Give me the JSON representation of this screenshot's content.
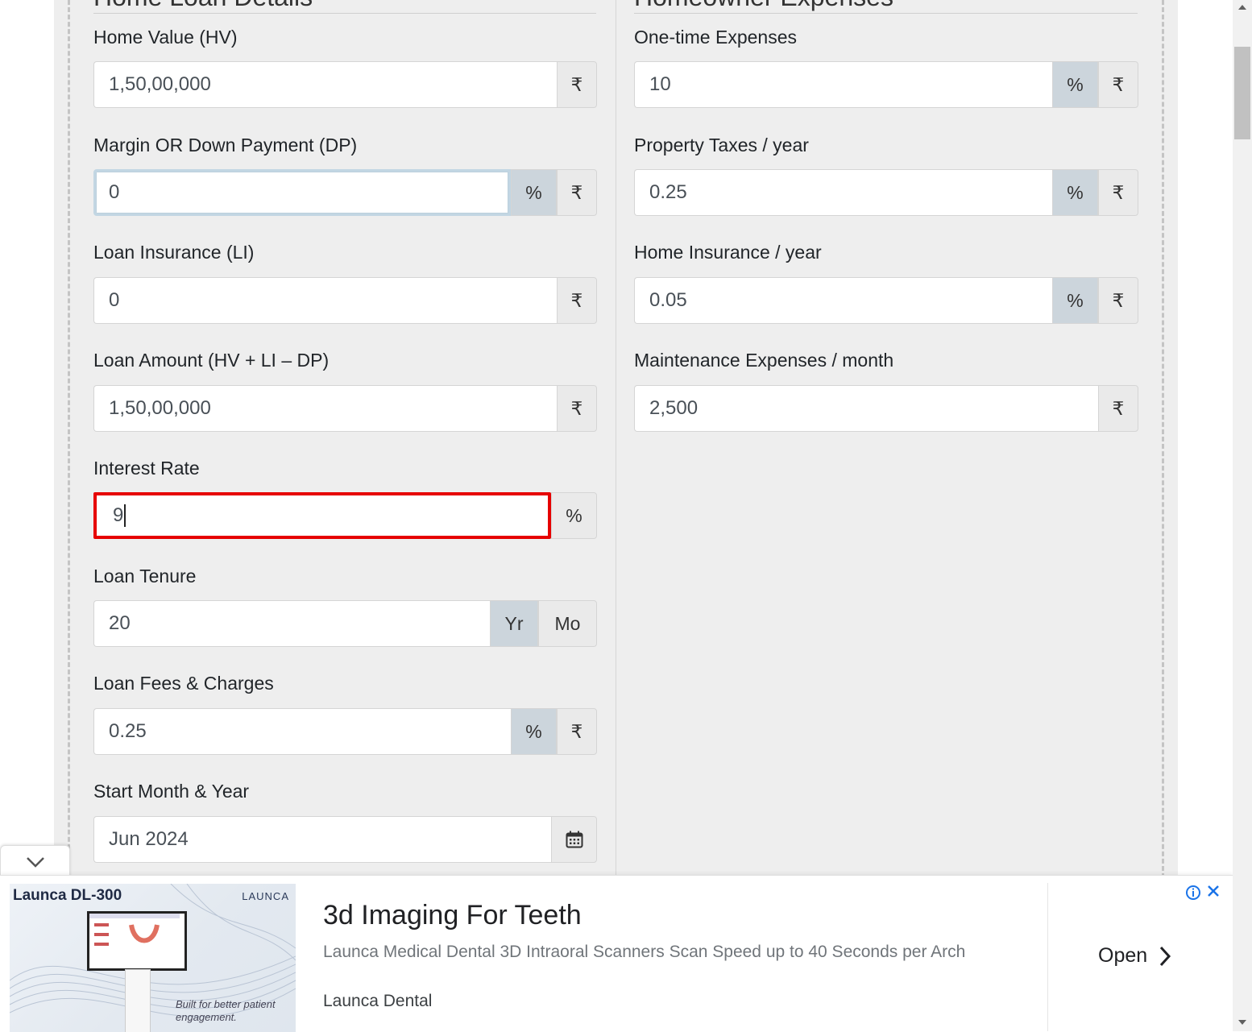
{
  "left_section": {
    "heading": "Home Loan Details",
    "home_value": {
      "label": "Home Value (HV)",
      "value": "1,50,00,000",
      "unit": "₹"
    },
    "down_payment": {
      "label": "Margin OR Down Payment (DP)",
      "value": "0",
      "pct": "%",
      "rupee": "₹"
    },
    "loan_insurance": {
      "label": "Loan Insurance (LI)",
      "value": "0",
      "unit": "₹"
    },
    "loan_amount": {
      "label": "Loan Amount (HV + LI – DP)",
      "value": "1,50,00,000",
      "unit": "₹"
    },
    "interest_rate": {
      "label": "Interest Rate",
      "value": "9",
      "unit": "%"
    },
    "loan_tenure": {
      "label": "Loan Tenure",
      "value": "20",
      "yr": "Yr",
      "mo": "Mo"
    },
    "loan_fees": {
      "label": "Loan Fees & Charges",
      "value": "0.25",
      "pct": "%",
      "rupee": "₹"
    },
    "start_date": {
      "label": "Start Month & Year",
      "value": "Jun 2024"
    }
  },
  "right_section": {
    "heading": "Homeowner Expenses",
    "one_time": {
      "label": "One-time Expenses",
      "value": "10",
      "pct": "%",
      "rupee": "₹"
    },
    "property_tax": {
      "label": "Property Taxes / year",
      "value": "0.25",
      "pct": "%",
      "rupee": "₹"
    },
    "home_insurance": {
      "label": "Home Insurance / year",
      "value": "0.05",
      "pct": "%",
      "rupee": "₹"
    },
    "maintenance": {
      "label": "Maintenance Expenses / month",
      "value": "2,500",
      "unit": "₹"
    }
  },
  "ad": {
    "image_brand": "Launca DL-300",
    "image_logo": "LAUNCA",
    "image_tagline": "Built for better patient engagement.",
    "title": "3d Imaging For Teeth",
    "description": "Launca Medical Dental 3D Intraoral Scanners Scan Speed up to 40 Seconds per Arch",
    "source": "Launca Dental",
    "cta": "Open"
  },
  "colors": {
    "highlight_border": "#e60000",
    "active_addon": "#ccd5dc",
    "panel_bg": "#eeeeee"
  }
}
